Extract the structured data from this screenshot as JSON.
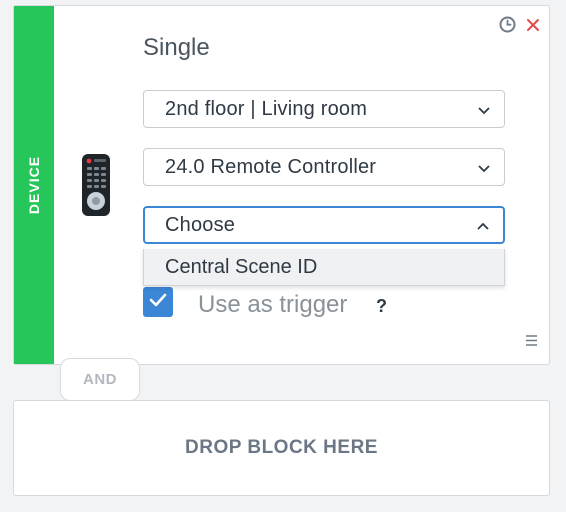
{
  "block": {
    "type_label": "DEVICE",
    "title": "Single",
    "location_select": {
      "value": "2nd floor | Living room"
    },
    "device_select": {
      "value": "24.0 Remote Controller"
    },
    "property_select": {
      "value": "Choose",
      "options": [
        "Central Scene ID"
      ]
    },
    "trigger": {
      "checked": true,
      "label": "Use as trigger",
      "help": "?"
    }
  },
  "connector": {
    "label": "AND"
  },
  "drop_zone": {
    "label": "DROP BLOCK HERE"
  },
  "colors": {
    "device_stripe": "#27c65a",
    "accent": "#3b87d6",
    "close": "#e24b4b"
  },
  "icons": [
    "clock-icon",
    "close-icon",
    "remote-control-icon",
    "chevron-down-icon",
    "chevron-up-icon",
    "check-icon",
    "hamburger-menu-icon"
  ]
}
